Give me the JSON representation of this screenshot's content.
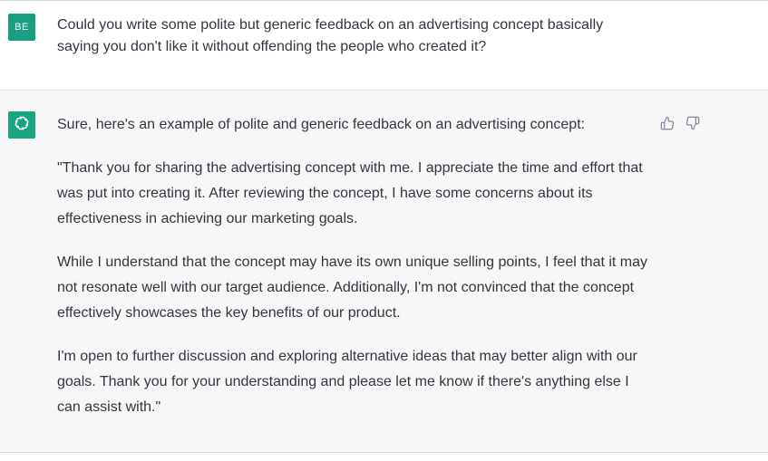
{
  "user_message": {
    "avatar_initials": "BE",
    "text": "Could you write some polite but generic feedback on an advertising concept basically saying you don't like it without offending the people who created it?"
  },
  "assistant_message": {
    "avatar_icon": "openai-logo-icon",
    "paragraphs": [
      "Sure, here's an example of polite and generic feedback on an advertising concept:",
      "\"Thank you for sharing the advertising concept with me. I appreciate the time and effort that was put into creating it. After reviewing the concept, I have some concerns about its effectiveness in achieving our marketing goals.",
      "While I understand that the concept may have its own unique selling points, I feel that it may not resonate well with our target audience. Additionally, I'm not convinced that the concept effectively showcases the key benefits of our product.",
      "I'm open to further discussion and exploring alternative ideas that may better align with our goals. Thank you for your understanding and please let me know if there's anything else I can assist with.\""
    ],
    "feedback_icons": [
      "thumbs-up-icon",
      "thumbs-down-icon"
    ]
  },
  "colors": {
    "user_avatar_bg": "#1a9f82",
    "assistant_avatar_bg": "#19a37f",
    "assistant_row_bg": "#f7f7f8",
    "text": "#343541"
  }
}
